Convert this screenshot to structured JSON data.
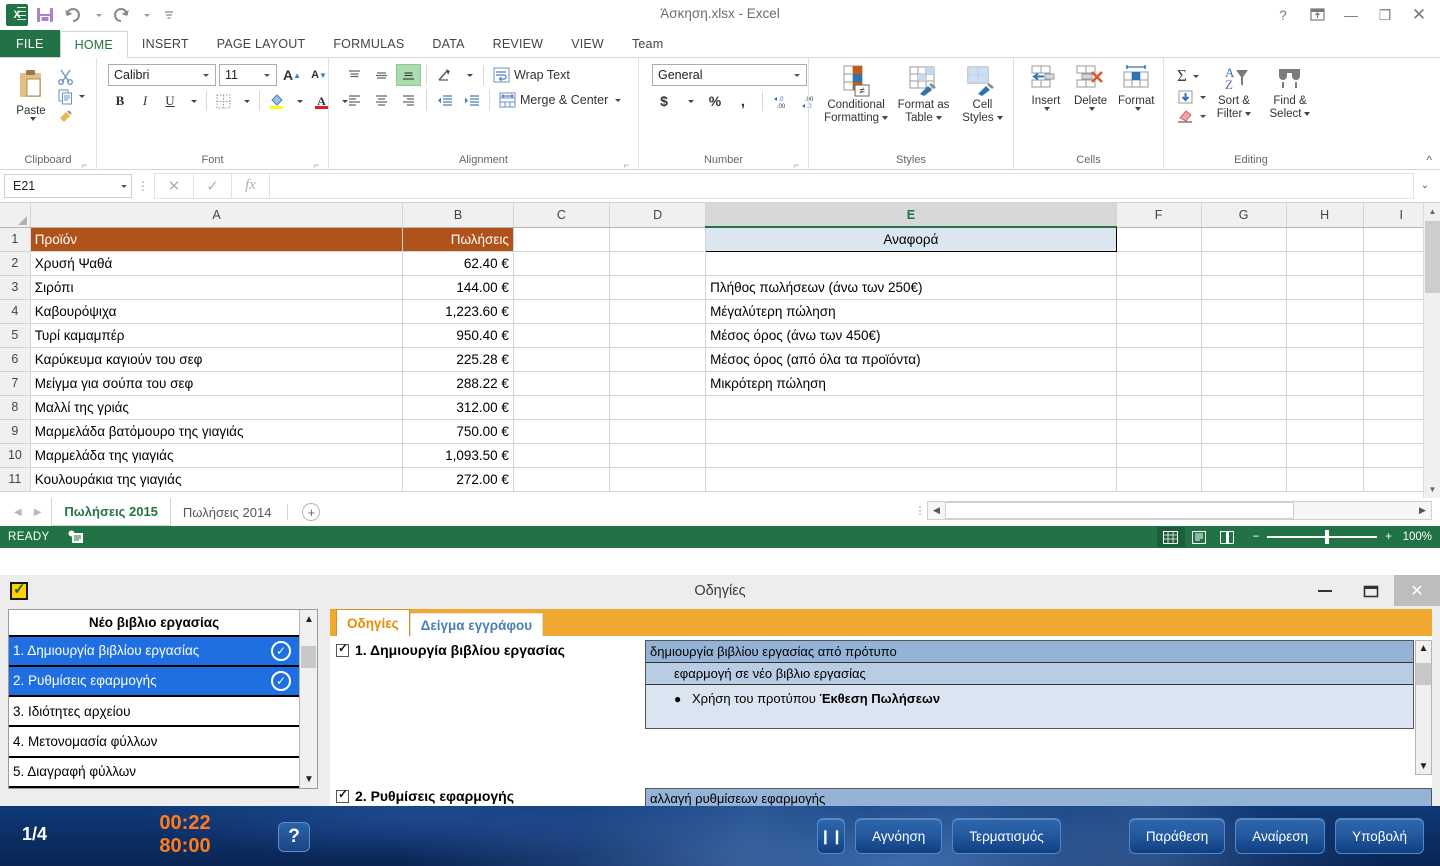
{
  "window": {
    "title": "Άσκηση.xlsx - Excel",
    "controls": {
      "help": "?",
      "ribbon_display": "⬒",
      "minimize": "—",
      "restore": "❐",
      "close": "✕"
    },
    "qat": {
      "save": "save-icon",
      "undo": "undo-icon",
      "redo": "redo-icon",
      "more": "customize-icon"
    }
  },
  "ribbon": {
    "tabs": [
      {
        "label": "FILE"
      },
      {
        "label": "HOME"
      },
      {
        "label": "INSERT"
      },
      {
        "label": "PAGE LAYOUT"
      },
      {
        "label": "FORMULAS"
      },
      {
        "label": "DATA"
      },
      {
        "label": "REVIEW"
      },
      {
        "label": "VIEW"
      },
      {
        "label": "Team"
      }
    ],
    "clipboard": {
      "group": "Clipboard",
      "paste": "Paste",
      "cut": "cut-icon",
      "copy": "copy-icon",
      "format_painter": "format-painter-icon"
    },
    "font": {
      "group": "Font",
      "family": "Calibri",
      "size": "11",
      "grow": "A",
      "shrink": "A",
      "bold": "B",
      "italic": "I",
      "underline": "U",
      "borders": "borders-icon",
      "fill": "fill-color-icon",
      "color": "font-color-icon"
    },
    "alignment": {
      "group": "Alignment",
      "wrap_text": "Wrap Text",
      "merge_center": "Merge & Center",
      "orientation": "orientation-icon",
      "indent_decrease": "decrease-indent-icon",
      "indent_increase": "increase-indent-icon"
    },
    "number": {
      "group": "Number",
      "format": "General",
      "currency": "$",
      "percent": "%",
      "comma": ",",
      "increase_decimal": ".00",
      "decrease_decimal": ".0"
    },
    "styles": {
      "group": "Styles",
      "conditional": "Conditional\nFormatting",
      "conditional_l1": "Conditional",
      "conditional_l2": "Formatting",
      "table_l1": "Format as",
      "table_l2": "Table",
      "cellstyles_l1": "Cell",
      "cellstyles_l2": "Styles"
    },
    "cells": {
      "group": "Cells",
      "insert": "Insert",
      "delete": "Delete",
      "format": "Format"
    },
    "editing": {
      "group": "Editing",
      "autosum": "Σ",
      "fill": "fill-down-icon",
      "clear": "clear-icon",
      "sort_l1": "Sort &",
      "sort_l2": "Filter",
      "find_l1": "Find &",
      "find_l2": "Select"
    },
    "collapse": "collapse-ribbon-icon"
  },
  "formula_bar": {
    "name_box": "E21",
    "cancel": "✕",
    "enter": "✓",
    "insert_function": "fx",
    "value": "",
    "expand": "expand-formula-bar-icon"
  },
  "sheet": {
    "columns": [
      "A",
      "B",
      "C",
      "D",
      "E",
      "F",
      "G",
      "H",
      "I"
    ],
    "selected_column": "E",
    "rows": [
      {
        "n": "1",
        "a": "Προϊόν",
        "b": "Πωλήσεις",
        "e": "Αναφορά"
      },
      {
        "n": "2",
        "a": "Χρυσή Ψαθά",
        "b": "62.40 €",
        "e": ""
      },
      {
        "n": "3",
        "a": "Σιρόπι",
        "b": "144.00 €",
        "e": "Πλήθος πωλήσεων (άνω των 250€)"
      },
      {
        "n": "4",
        "a": "Καβουρόψιχα",
        "b": "1,223.60 €",
        "e": "Μέγαλύτερη πώληση"
      },
      {
        "n": "5",
        "a": "Τυρί καμαμπέρ",
        "b": "950.40 €",
        "e": "Μέσος όρος (άνω των 450€)"
      },
      {
        "n": "6",
        "a": "Καρύκευμα καγιούν του σεφ",
        "b": "225.28 €",
        "e": "Μέσος όρος (από όλα τα προϊόντα)"
      },
      {
        "n": "7",
        "a": "Μείγμα για σούπα του σεφ",
        "b": "288.22 €",
        "e": "Μικρότερη πώληση"
      },
      {
        "n": "8",
        "a": "Μαλλί της γριάς",
        "b": "312.00 €",
        "e": ""
      },
      {
        "n": "9",
        "a": "Μαρμελάδα βατόμουρο της γιαγιάς",
        "b": "750.00 €",
        "e": ""
      },
      {
        "n": "10",
        "a": "Μαρμελάδα της γιαγιάς",
        "b": "1,093.50 €",
        "e": ""
      },
      {
        "n": "11",
        "a": "Κουλουράκια της γιαγιάς",
        "b": "272.00 €",
        "e": ""
      }
    ],
    "tabs": [
      {
        "label": "Πωλήσεις 2015",
        "active": true
      },
      {
        "label": "Πωλήσεις 2014",
        "active": false
      }
    ],
    "add_sheet": "+"
  },
  "status_bar": {
    "state": "READY",
    "macro": "record-macro-icon",
    "views": [
      "normal-view-icon",
      "page-layout-icon",
      "page-break-icon"
    ],
    "zoom_out": "−",
    "zoom_in": "+",
    "zoom": "100%"
  },
  "instructions": {
    "title": "Οδηγίες",
    "icon": "checklist-icon",
    "controls": {
      "minimize": "—",
      "restore": "❐",
      "close": "✕"
    },
    "task_list": {
      "header": "Νέο βιβλιο εργασίας",
      "items": [
        {
          "label": "1. Δημιουργία βιβλίου εργασίας",
          "selected": true,
          "done": true
        },
        {
          "label": "2. Ρυθμίσεις εφαρμογής",
          "selected": true,
          "done": true
        },
        {
          "label": "3. Ιδιότητες αρχείου",
          "selected": false,
          "done": false
        },
        {
          "label": "4. Μετονομασία φύλλων",
          "selected": false,
          "done": false
        },
        {
          "label": "5. Διαγραφή φύλλων",
          "selected": false,
          "done": false
        }
      ]
    },
    "tabs": [
      {
        "label": "Οδηγίες",
        "active": true
      },
      {
        "label": "Δείγμα εγγράφου",
        "active": false
      }
    ],
    "task1": {
      "title": "1. Δημιουργία βιβλίου εργασίας",
      "detail_row1": "δημιουργία βιβλίου εργασίας από πρότυπο",
      "detail_row2": "εφαρμογή σε νέο βιβλιο εργασίας",
      "bullet": "●",
      "bullet_prefix": "Χρήση του προτύπου ",
      "bullet_bold": "Έκθεση Πωλήσεων"
    },
    "task2": {
      "title": "2. Ρυθμίσεις εφαρμογής",
      "detail_row1": "αλλαγή ρυθμίσεων εφαρμογής"
    }
  },
  "taskbar": {
    "page": "1/4",
    "elapsed": "00:22",
    "total": "80:00",
    "help": "?",
    "pause": "❙❙",
    "buttons": [
      {
        "label": "Αγνόηση"
      },
      {
        "label": "Τερματισμός"
      },
      {
        "label": "Παράθεση"
      },
      {
        "label": "Αναίρεση"
      },
      {
        "label": "Υποβολή"
      }
    ]
  }
}
